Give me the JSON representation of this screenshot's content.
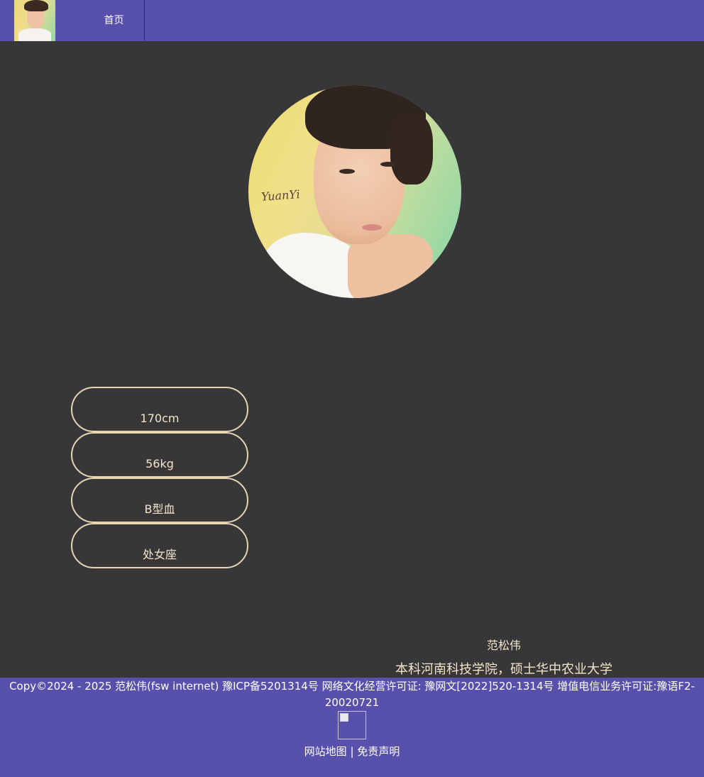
{
  "nav": {
    "home_label": "首页"
  },
  "avatar": {
    "signature": "YuanYi"
  },
  "profile": {
    "items": [
      {
        "label": "170cm"
      },
      {
        "label": "56kg"
      },
      {
        "label": "B型血"
      },
      {
        "label": "处女座"
      }
    ],
    "name": "范松伟",
    "education": "本科河南科技学院，硕士华中农业大学"
  },
  "footer": {
    "copyright": "Copy©2024 - 2025 范松伟(fsw internet) 豫ICP备5201314号 网络文化经营许可证: 豫网文[2022]520-1314号 增值电信业务许可证:豫语F2-20020721",
    "sitemap_label": "网站地图",
    "separator": "|",
    "disclaimer_label": "免责声明"
  },
  "colors": {
    "header_bg": "#5751ab",
    "page_bg": "#373639",
    "pill_border": "#e6d5b0",
    "text_cream": "#f2e6c8"
  }
}
